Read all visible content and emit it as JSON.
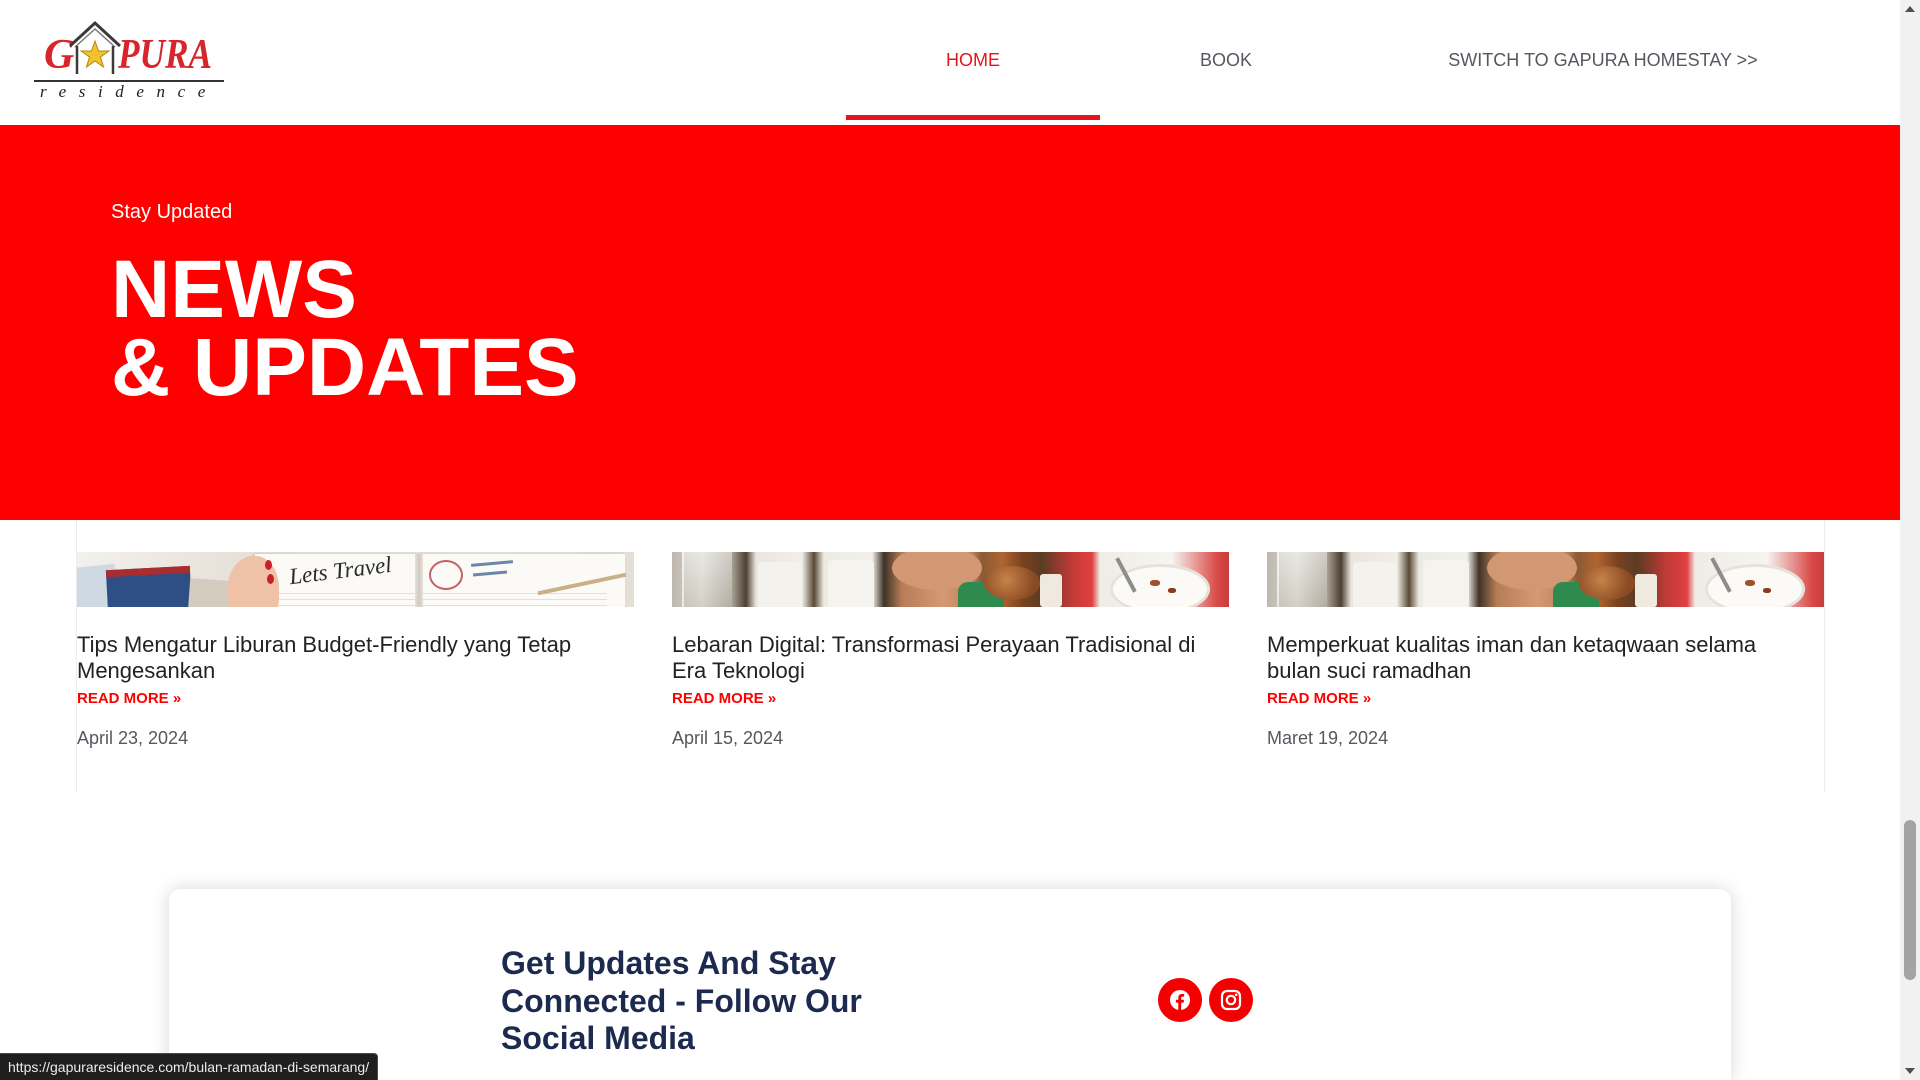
{
  "colors": {
    "brand_red": "#ff0000",
    "nav_text": "#54595f",
    "heading_navy": "#1c2a4f"
  },
  "header": {
    "logo": {
      "letter_g": "G",
      "letters_pura": "PURA",
      "tagline": "residence"
    },
    "nav": [
      {
        "label": "HOME",
        "active": true
      },
      {
        "label": "BOOK",
        "active": false
      },
      {
        "label": "SWITCH TO GAPURA HOMESTAY >>",
        "active": false
      }
    ]
  },
  "hero": {
    "eyebrow": "Stay Updated",
    "title_line1": "NEWS",
    "title_line2": "& UPDATES"
  },
  "posts": [
    {
      "title": "Tips Mengatur Liburan Budget-Friendly yang Tetap Mengesankan",
      "read_more": "READ MORE »",
      "date": "April 23, 2024",
      "image_text": "Lets Travel"
    },
    {
      "title": "Lebaran Digital: Transformasi Perayaan Tradisional di Era Teknologi",
      "read_more": "READ MORE »",
      "date": "April 15, 2024"
    },
    {
      "title": "Memperkuat kualitas iman dan ketaqwaan selama bulan suci ramadhan",
      "read_more": "READ MORE »",
      "date": "Maret 19, 2024"
    }
  ],
  "newsletter": {
    "heading": "Get Updates And Stay Connected - Follow Our Social Media",
    "social": [
      {
        "icon": "facebook-icon"
      },
      {
        "icon": "instagram-icon"
      }
    ]
  },
  "status_bar": {
    "url": "https://gapuraresidence.com/bulan-ramadan-di-semarang/"
  }
}
